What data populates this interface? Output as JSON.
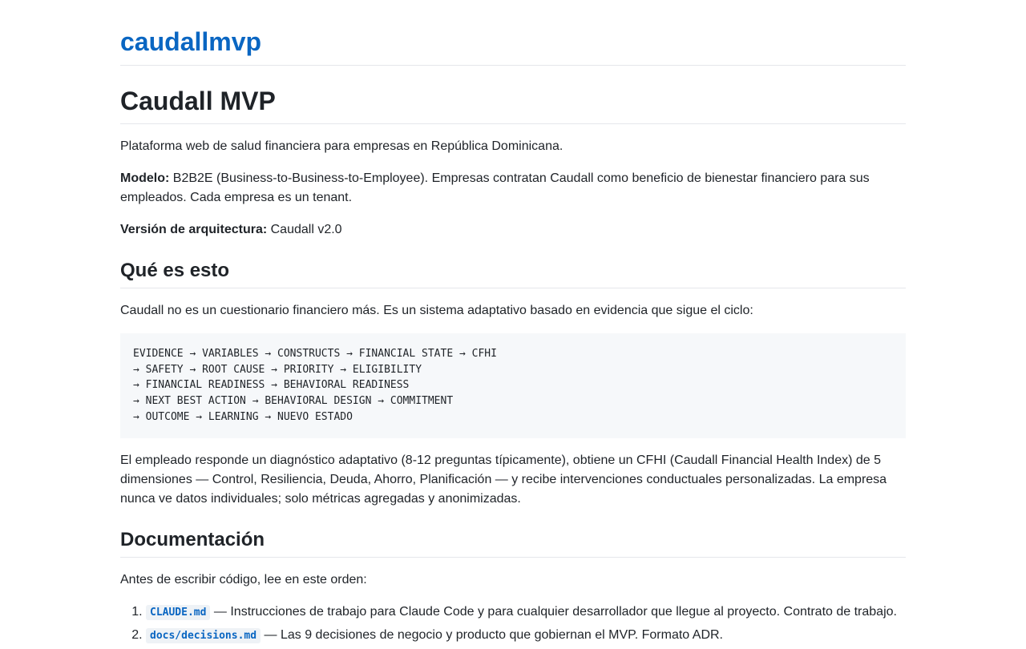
{
  "site": {
    "title": "caudallmvp"
  },
  "page": {
    "h1": "Caudall MVP",
    "intro": "Plataforma web de salud financiera para empresas en República Dominicana.",
    "model_label": "Modelo:",
    "model_text": " B2B2E (Business-to-Business-to-Employee). Empresas contratan Caudall como beneficio de bienestar financiero para sus empleados. Cada empresa es un tenant.",
    "version_label": "Versión de arquitectura:",
    "version_text": " Caudall v2.0"
  },
  "section_que": {
    "heading": "Qué es esto",
    "lead": "Caudall no es un cuestionario financiero más. Es un sistema adaptativo basado en evidencia que sigue el ciclo:",
    "flow": [
      "EVIDENCE → VARIABLES → CONSTRUCTS → FINANCIAL STATE → CFHI",
      "→ SAFETY → ROOT CAUSE → PRIORITY → ELIGIBILITY",
      "→ FINANCIAL READINESS → BEHAVIORAL READINESS",
      "→ NEXT BEST ACTION → BEHAVIORAL DESIGN → COMMITMENT",
      "→ OUTCOME → LEARNING → NUEVO ESTADO"
    ],
    "body": "El empleado responde un diagnóstico adaptativo (8-12 preguntas típicamente), obtiene un CFHI (Caudall Financial Health Index) de 5 dimensiones — Control, Resiliencia, Deuda, Ahorro, Planificación — y recibe intervenciones conductuales personalizadas. La empresa nunca ve datos individuales; solo métricas agregadas y anonimizadas."
  },
  "section_docs": {
    "heading": "Documentación",
    "lead": "Antes de escribir código, lee en este orden:",
    "items": [
      {
        "code": "CLAUDE.md",
        "text": " — Instrucciones de trabajo para Claude Code y para cualquier desarrollador que llegue al proyecto. Contrato de trabajo."
      },
      {
        "code": "docs/decisions.md",
        "text": " — Las 9 decisiones de negocio y producto que gobiernan el MVP. Formato ADR."
      }
    ]
  }
}
